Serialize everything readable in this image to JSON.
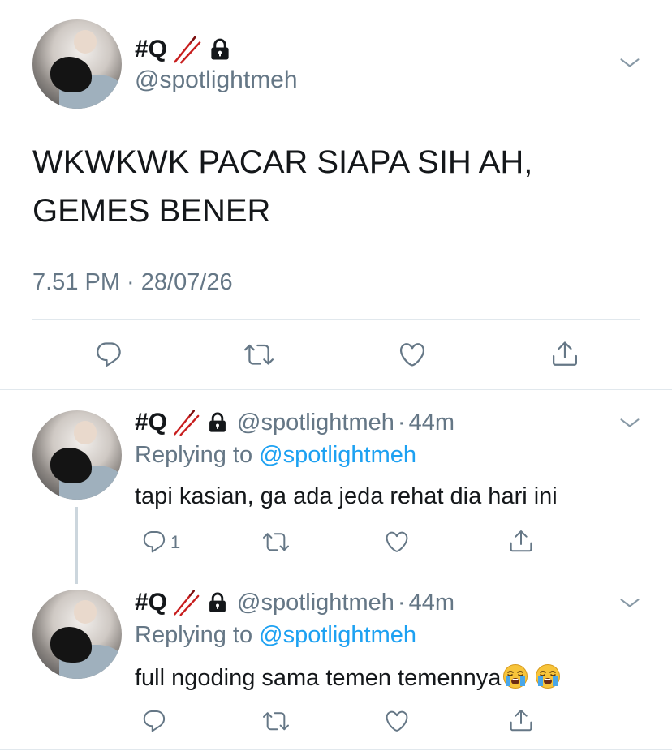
{
  "main_tweet": {
    "display_name": "#Q",
    "handle": "@spotlightmeh",
    "text_line1": "WKWKWK PACAR SIAPA SIH AH,",
    "text_line2": "GEMES BENER",
    "timestamp": "7.51 PM · 28/07/26",
    "icons": [
      "reply-icon",
      "retweet-icon",
      "like-icon",
      "share-icon"
    ]
  },
  "replies": [
    {
      "display_name": "#Q",
      "handle": "@spotlightmeh",
      "separator": "·",
      "time": "44m",
      "replying_prefix": "Replying to ",
      "replying_to": "@spotlightmeh",
      "text": "tapi kasian, ga ada jeda rehat dia hari ini",
      "reply_count": "1"
    },
    {
      "display_name": "#Q",
      "handle": "@spotlightmeh",
      "separator": "·",
      "time": "44m",
      "replying_prefix": "Replying to ",
      "replying_to": "@spotlightmeh",
      "text": "full ngoding sama temen temennya",
      "emojis": [
        "loudly-crying-face",
        "loudly-crying-face"
      ],
      "reply_count": ""
    }
  ],
  "colors": {
    "text": "#14171a",
    "secondary": "#657786",
    "accent": "#1da1f2",
    "divider": "#e1e8ed"
  }
}
